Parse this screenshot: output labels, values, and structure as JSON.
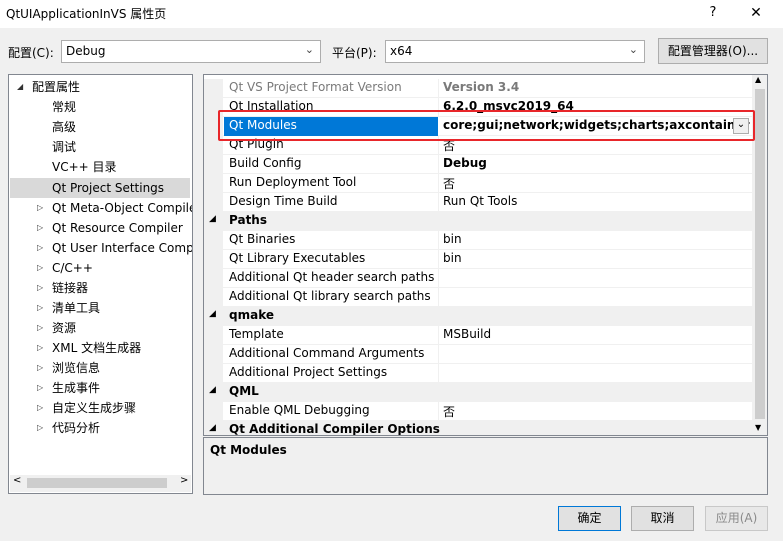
{
  "window": {
    "title": "QtUIApplicationInVS 属性页",
    "help_label": "?",
    "close_label": "✕"
  },
  "toolbar": {
    "config_label": "配置(C):",
    "config_value": "Debug",
    "platform_label": "平台(P):",
    "platform_value": "x64",
    "manager_button": "配置管理器(O)..."
  },
  "tree": {
    "root": "配置属性",
    "items": [
      {
        "label": "常规"
      },
      {
        "label": "高级"
      },
      {
        "label": "调试"
      },
      {
        "label": "VC++ 目录"
      },
      {
        "label": "Qt Project Settings"
      },
      {
        "label": "Qt Meta-Object Compile"
      },
      {
        "label": "Qt Resource Compiler"
      },
      {
        "label": "Qt User Interface Comp"
      },
      {
        "label": "C/C++"
      },
      {
        "label": "链接器"
      },
      {
        "label": "清单工具"
      },
      {
        "label": "资源"
      },
      {
        "label": "XML 文档生成器"
      },
      {
        "label": "浏览信息"
      },
      {
        "label": "生成事件"
      },
      {
        "label": "自定义生成步骤"
      },
      {
        "label": "代码分析"
      }
    ]
  },
  "grid": {
    "rows": [
      {
        "name": "Qt VS Project Format Version",
        "value": "Version 3.4"
      },
      {
        "name": "Qt Installation",
        "value": "6.2.0_msvc2019_64"
      },
      {
        "name": "Qt Modules",
        "value": "core;gui;network;widgets;charts;axcontainer"
      },
      {
        "name": "Qt Plugin",
        "value": "否"
      },
      {
        "name": "Build Config",
        "value": "Debug"
      },
      {
        "name": "Run Deployment Tool",
        "value": "否"
      },
      {
        "name": "Design Time Build",
        "value": "Run Qt Tools"
      }
    ],
    "paths_category": "Paths",
    "paths_rows": [
      {
        "name": "Qt Binaries",
        "value": "bin"
      },
      {
        "name": "Qt Library Executables",
        "value": "bin"
      },
      {
        "name": "Additional Qt header search paths",
        "value": ""
      },
      {
        "name": "Additional Qt library search paths",
        "value": ""
      }
    ],
    "qmake_category": "qmake",
    "qmake_rows": [
      {
        "name": "Template",
        "value": "MSBuild"
      },
      {
        "name": "Additional Command Arguments",
        "value": ""
      },
      {
        "name": "Additional Project Settings",
        "value": ""
      }
    ],
    "qml_category": "QML",
    "qml_rows": [
      {
        "name": "Enable QML Debugging",
        "value": "否"
      }
    ],
    "compiler_category": "Qt Additional Compiler Options"
  },
  "description": {
    "title": "Qt Modules"
  },
  "buttons": {
    "ok": "确定",
    "cancel": "取消",
    "apply": "应用(A)"
  }
}
